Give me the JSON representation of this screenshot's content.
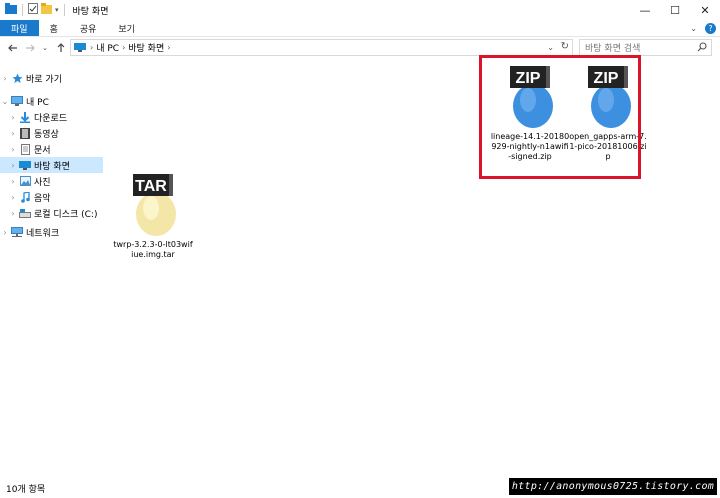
{
  "window": {
    "title": "바탕 화면",
    "controls": {
      "minimize": "—",
      "maximize": "☐",
      "close": "✕"
    }
  },
  "ribbon": {
    "tabs": [
      "파일",
      "홈",
      "공유",
      "보기"
    ],
    "help": "?"
  },
  "address": {
    "crumbs": [
      "내 PC",
      "바탕 화면"
    ],
    "search_placeholder": "바탕 화면 검색"
  },
  "nav": {
    "items": [
      {
        "label": "바로 가기",
        "icon": "star-icon",
        "selected": false
      },
      {
        "label": "내 PC",
        "icon": "pc-icon",
        "selected": false
      },
      {
        "label": "다운로드",
        "icon": "download-icon",
        "selected": false
      },
      {
        "label": "동영상",
        "icon": "video-icon",
        "selected": false
      },
      {
        "label": "문서",
        "icon": "document-icon",
        "selected": false
      },
      {
        "label": "바탕 화면",
        "icon": "desktop-icon",
        "selected": true
      },
      {
        "label": "사진",
        "icon": "picture-icon",
        "selected": false
      },
      {
        "label": "음악",
        "icon": "music-icon",
        "selected": false
      },
      {
        "label": "로컬 디스크 (C:)",
        "icon": "disk-icon",
        "selected": false
      },
      {
        "label": "네트워크",
        "icon": "network-icon",
        "selected": false
      }
    ]
  },
  "files": [
    {
      "badge": "ZIP",
      "name": "lineage-14.1-20180929-nightly-n1awifi-signed.zip",
      "color": "#3d8fe0"
    },
    {
      "badge": "ZIP",
      "name": "open_gapps-arm-7.1-pico-20181006.zip",
      "color": "#3d8fe0"
    },
    {
      "badge": "TAR",
      "name": "twrp-3.2.3-0-lt03wifiue.img.tar",
      "color": "#f3e6a7"
    }
  ],
  "status": {
    "count": "10개 항목"
  },
  "watermark": "http://anonymous0725.tistory.com",
  "colors": {
    "accent": "#1979ca",
    "selection": "#cce8ff",
    "highlight": "#d9142b"
  }
}
